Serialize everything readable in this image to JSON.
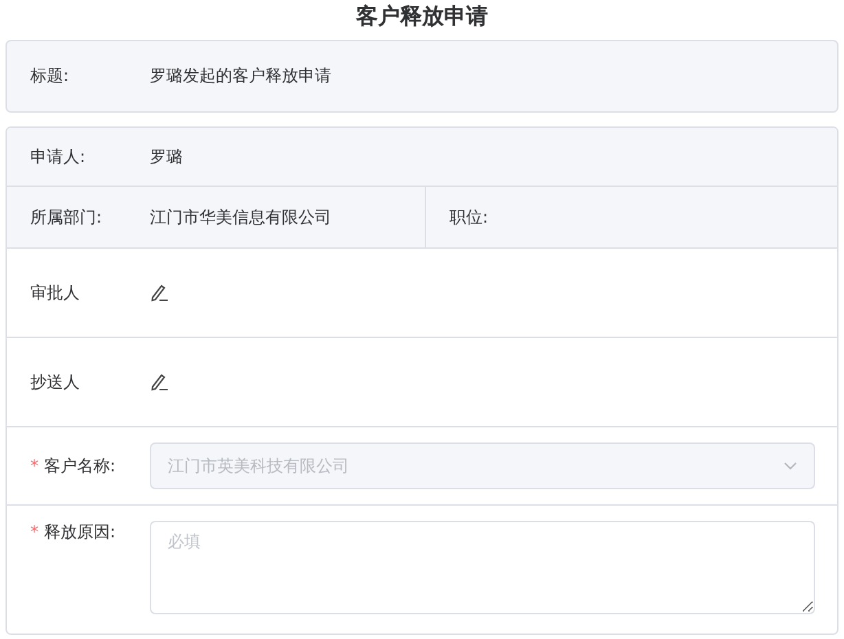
{
  "page_title": "客户释放申请",
  "title_row": {
    "label": "标题:",
    "value": "罗璐发起的客户释放申请"
  },
  "applicant": {
    "label": "申请人:",
    "value": "罗璐"
  },
  "department": {
    "label": "所属部门:",
    "value": "江门市华美信息有限公司"
  },
  "position": {
    "label": "职位:"
  },
  "approver": {
    "label": "审批人"
  },
  "cc": {
    "label": "抄送人"
  },
  "customer": {
    "label": "客户名称:",
    "required_mark": "*",
    "value": "江门市英美科技有限公司",
    "disabled": true
  },
  "reason": {
    "label": "释放原因:",
    "required_mark": "*",
    "placeholder": "必填"
  }
}
